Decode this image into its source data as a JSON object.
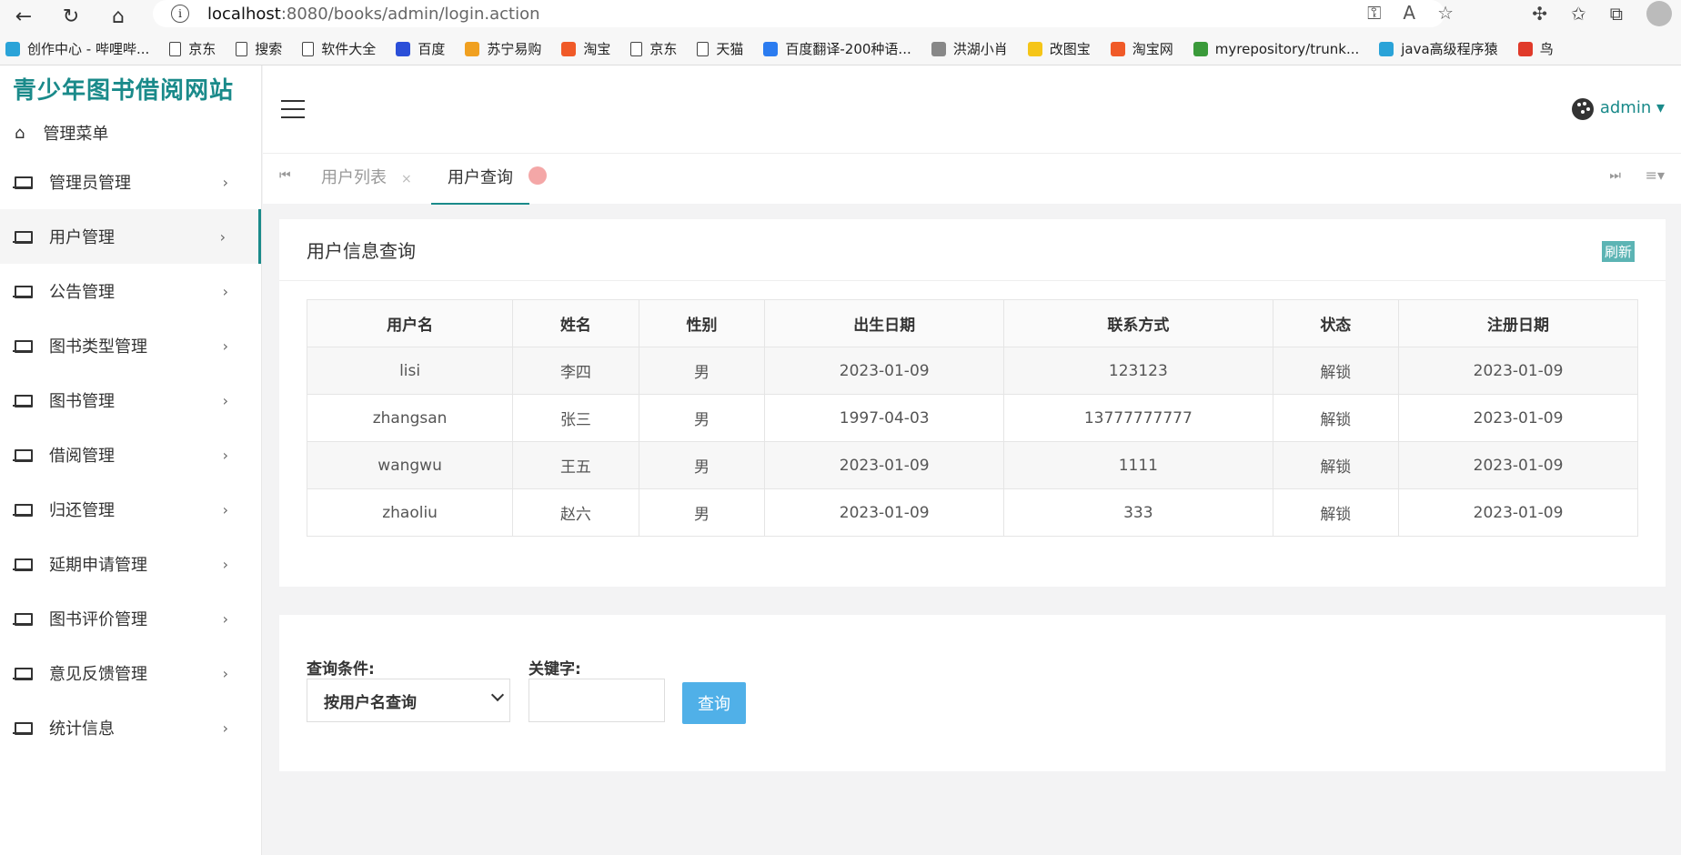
{
  "browser": {
    "url_host": "localhost",
    "url_path": ":8080/books/admin/login.action",
    "bookmarks": [
      {
        "label": "创作中心 - 哔哩哔...",
        "color": "#2aa3d8"
      },
      {
        "label": "京东",
        "color": "doc"
      },
      {
        "label": "搜索",
        "color": "doc"
      },
      {
        "label": "软件大全",
        "color": "doc"
      },
      {
        "label": "百度",
        "color": "#2b4fd8"
      },
      {
        "label": "苏宁易购",
        "color": "#f0a020"
      },
      {
        "label": "淘宝",
        "color": "#f05a28"
      },
      {
        "label": "京东",
        "color": "doc"
      },
      {
        "label": "天猫",
        "color": "doc"
      },
      {
        "label": "百度翻译-200种语...",
        "color": "#2b7cf0"
      },
      {
        "label": "洪湖小肖",
        "color": "#888"
      },
      {
        "label": "改图宝",
        "color": "#f5c518"
      },
      {
        "label": "淘宝网",
        "color": "#f05a28"
      },
      {
        "label": "myrepository/trunk...",
        "color": "#3a9a3a"
      },
      {
        "label": "java高级程序猿",
        "color": "#2aa3d8"
      },
      {
        "label": "鸟",
        "color": "#e03a2a"
      }
    ]
  },
  "app": {
    "title": "青少年图书借阅网站",
    "menu_head": "管理菜单",
    "menu": [
      {
        "label": "管理员管理",
        "active": false
      },
      {
        "label": "用户管理",
        "active": true
      },
      {
        "label": "公告管理",
        "active": false
      },
      {
        "label": "图书类型管理",
        "active": false
      },
      {
        "label": "图书管理",
        "active": false
      },
      {
        "label": "借阅管理",
        "active": false
      },
      {
        "label": "归还管理",
        "active": false
      },
      {
        "label": "延期申请管理",
        "active": false
      },
      {
        "label": "图书评价管理",
        "active": false
      },
      {
        "label": "意见反馈管理",
        "active": false
      },
      {
        "label": "统计信息",
        "active": false
      }
    ],
    "user": "admin",
    "tabs": [
      {
        "label": "用户列表",
        "close": "×"
      },
      {
        "label": "用户查询"
      }
    ]
  },
  "panel": {
    "title": "用户信息查询",
    "refresh": "刷新",
    "columns": [
      "用户名",
      "姓名",
      "性别",
      "出生日期",
      "联系方式",
      "状态",
      "注册日期"
    ],
    "rows": [
      [
        "lisi",
        "李四",
        "男",
        "2023-01-09",
        "123123",
        "解锁",
        "2023-01-09"
      ],
      [
        "zhangsan",
        "张三",
        "男",
        "1997-04-03",
        "13777777777",
        "解锁",
        "2023-01-09"
      ],
      [
        "wangwu",
        "王五",
        "男",
        "2023-01-09",
        "1111",
        "解锁",
        "2023-01-09"
      ],
      [
        "zhaoliu",
        "赵六",
        "男",
        "2023-01-09",
        "333",
        "解锁",
        "2023-01-09"
      ]
    ]
  },
  "query": {
    "condition_label": "查询条件:",
    "condition_value": "按用户名查询",
    "keyword_label": "关键字:",
    "keyword_value": "",
    "submit": "查询"
  }
}
